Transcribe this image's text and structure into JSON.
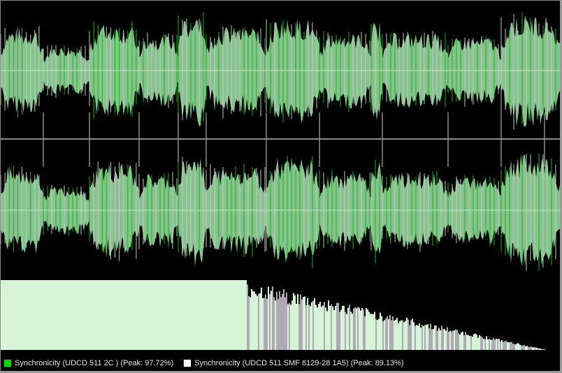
{
  "view": {
    "background": "#000000",
    "tracks": [
      {
        "name": "Synchronicity (UDCD 511 2C )",
        "color": "#00d800",
        "peak": 97.72
      },
      {
        "name": "Synchronicity (UDCD 511 SMF 8129-28 1A5)",
        "color": "#ffffff",
        "peak": 89.13
      }
    ],
    "fill_color": "#86c48e",
    "spectrum_color": "#d6f5d6",
    "spectrum_overlay_color": "#b0a8b4"
  },
  "legend": {
    "entries": [
      {
        "label": "Synchronicity (UDCD 511 2C ) (Peak: 97.72%)",
        "color": "#00d800"
      },
      {
        "label": "Synchronicity (UDCD 511 SMF 8129-28 1A5) (Peak: 89.13%)",
        "color": "#ffffff"
      }
    ]
  },
  "chart_data": {
    "type": "area",
    "channels": 2,
    "segments": [
      {
        "start": 0,
        "end": 61,
        "level": 0.7
      },
      {
        "start": 61,
        "end": 127,
        "level": 0.4
      },
      {
        "start": 127,
        "end": 198,
        "level": 0.78
      },
      {
        "start": 198,
        "end": 254,
        "level": 0.6
      },
      {
        "start": 254,
        "end": 294,
        "level": 0.92
      },
      {
        "start": 294,
        "end": 380,
        "level": 0.72
      },
      {
        "start": 380,
        "end": 456,
        "level": 0.86
      },
      {
        "start": 456,
        "end": 530,
        "level": 0.62
      },
      {
        "start": 530,
        "end": 546,
        "level": 0.82
      },
      {
        "start": 546,
        "end": 640,
        "level": 0.62
      },
      {
        "start": 640,
        "end": 716,
        "level": 0.56
      },
      {
        "start": 716,
        "end": 800,
        "level": 0.92
      }
    ],
    "markers": [
      61,
      127,
      198,
      254,
      294,
      380,
      456,
      546,
      640,
      716,
      778
    ],
    "spectrum_flat_until": 0.44,
    "spectrum_end": 0.975
  }
}
